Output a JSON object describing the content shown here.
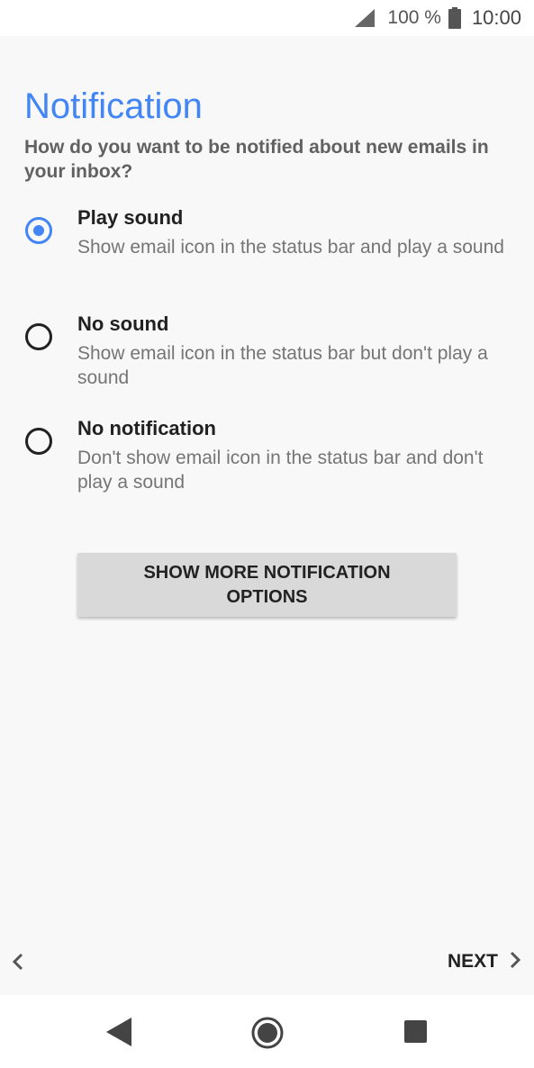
{
  "status_bar": {
    "battery_text": "100 %",
    "time": "10:00",
    "icons": [
      "signal-icon",
      "battery-icon"
    ]
  },
  "screen": {
    "title": "Notification",
    "subtitle": "How do you want to be notified about new emails in your inbox?"
  },
  "options": [
    {
      "title": "Play sound",
      "description": "Show email icon in the status bar and play a sound",
      "selected": true
    },
    {
      "title": "No sound",
      "description": "Show email icon in the status bar but don't play a sound",
      "selected": false
    },
    {
      "title": "No notification",
      "description": "Don't show email icon in the status bar and don't play a sound",
      "selected": false
    }
  ],
  "more_button": {
    "label": "SHOW MORE NOTIFICATION OPTIONS"
  },
  "footer": {
    "next_label": "NEXT"
  },
  "colors": {
    "accent": "#4285f4",
    "background": "#f8f8f8",
    "button": "#d9d9d9"
  }
}
